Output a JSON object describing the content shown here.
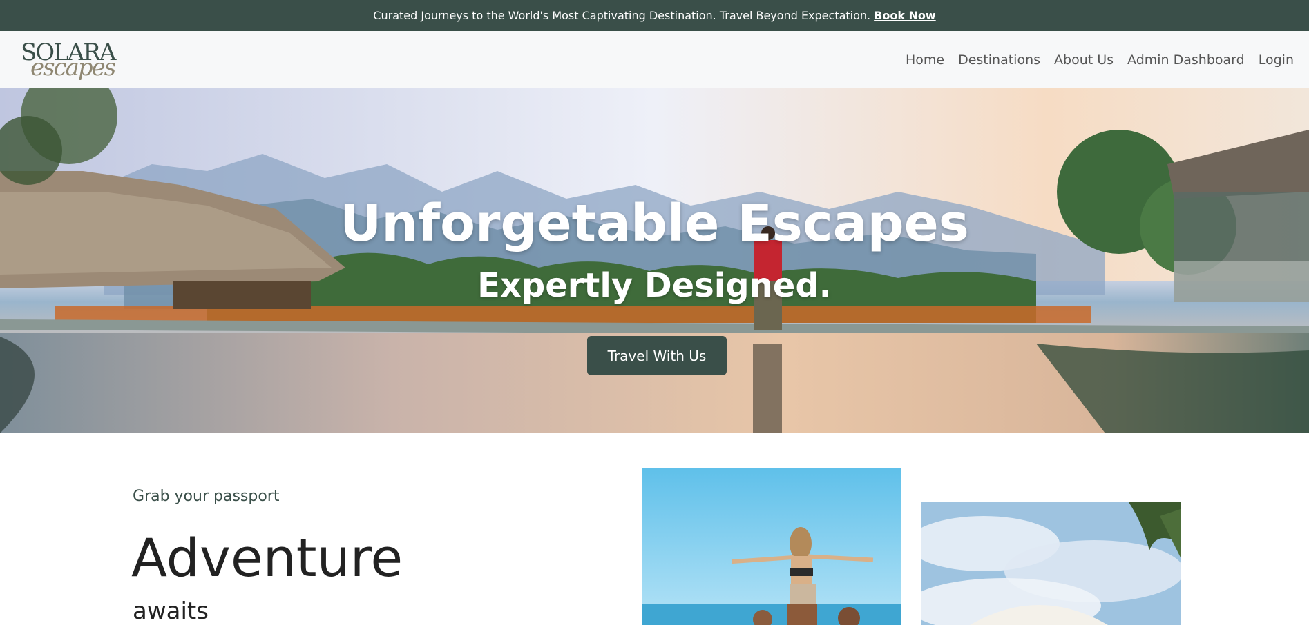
{
  "announcement": {
    "text": "Curated Journeys to the World's Most Captivating Destination. Travel Beyond Expectation.",
    "link_label": "Book Now"
  },
  "brand": {
    "line1": "SOLARA",
    "line2": "escapes"
  },
  "nav": {
    "items": [
      {
        "label": "Home"
      },
      {
        "label": "Destinations"
      },
      {
        "label": "About Us"
      },
      {
        "label": "Admin Dashboard"
      },
      {
        "label": "Login"
      }
    ]
  },
  "hero": {
    "title": "Unforgetable Escapes",
    "subtitle": "Expertly Designed.",
    "cta_label": "Travel With Us"
  },
  "intro": {
    "kicker": "Grab your passport",
    "title": "Adventure",
    "subtitle": "awaits"
  },
  "colors": {
    "brand_dark": "#3a4f49",
    "brand_tan": "#8f8772",
    "nav_bg": "#f7f8f9",
    "nav_text": "#555555"
  }
}
